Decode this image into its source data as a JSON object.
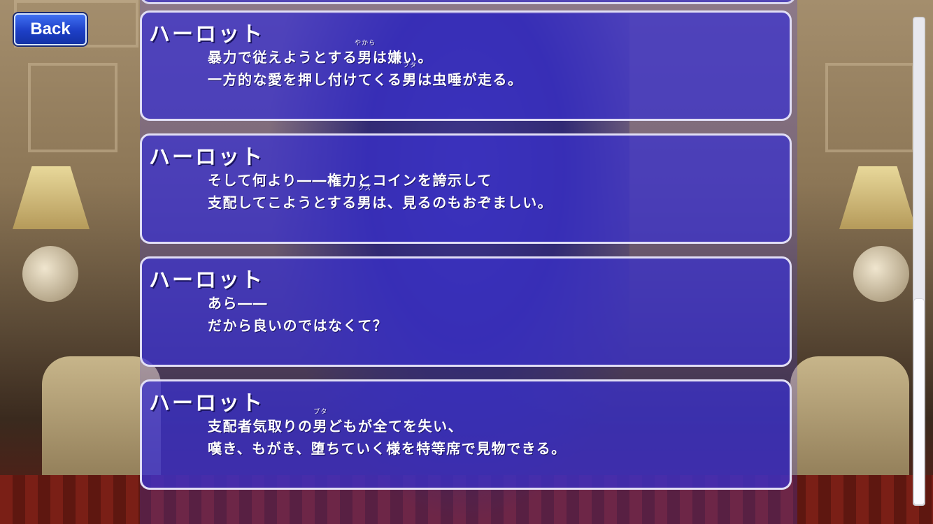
{
  "back_button": {
    "label": "Back"
  },
  "log": [
    {
      "speaker": "ハーロット",
      "line1_before": "暴力で従えようとする",
      "line1_ruby_base": "男",
      "line1_ruby_text": "やから",
      "line1_after": "は嫌い。",
      "line2_before": "一方的な愛を押し付けてくる",
      "line2_ruby_base": "男",
      "line2_ruby_text": "ブタ",
      "line2_after": "は虫唾が走る。"
    },
    {
      "speaker": "ハーロット",
      "line1_before": "そして何より――権力とコインを誇示して",
      "line1_ruby_base": "",
      "line1_ruby_text": "",
      "line1_after": "",
      "line2_before": "支配してこようとする",
      "line2_ruby_base": "男",
      "line2_ruby_text": "クズ",
      "line2_after": "は、見るのもおぞましい。"
    },
    {
      "speaker": "ハーロット",
      "line1_before": "あら――",
      "line1_ruby_base": "",
      "line1_ruby_text": "",
      "line1_after": "",
      "line2_before": "だから良いのではなくて？",
      "line2_ruby_base": "",
      "line2_ruby_text": "",
      "line2_after": ""
    },
    {
      "speaker": "ハーロット",
      "line1_before": "支配者気取りの",
      "line1_ruby_base": "男",
      "line1_ruby_text": "ブタ",
      "line1_after": "どもが全てを失い、",
      "line2_before": "嘆き、もがき、堕ちていく様を特等席で見物できる。",
      "line2_ruby_base": "",
      "line2_ruby_text": "",
      "line2_after": ""
    }
  ],
  "scroll": {
    "position": 0.62
  }
}
